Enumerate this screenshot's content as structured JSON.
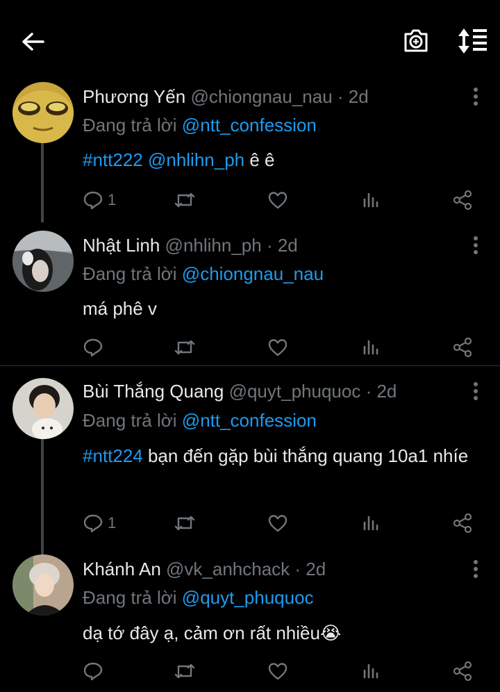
{
  "icons": {
    "back": "arrow-left-icon",
    "camera": "camera-plus-icon",
    "sort": "sort-icon",
    "more": "more-vertical-icon",
    "reply": "reply-icon",
    "retweet": "retweet-icon",
    "like": "heart-icon",
    "views": "bar-chart-icon",
    "share": "share-icon"
  },
  "colors": {
    "accent": "#1d9bf0",
    "muted": "#71767b",
    "background": "#000000"
  },
  "replying_prefix": "Đang trả lời",
  "tweets": [
    {
      "name": "Phương Yến",
      "handle": "@chiongnau_nau",
      "time": "· 2d",
      "reply_to": "@ntt_confession",
      "text_tag": "#ntt222 @nhlihn_ph",
      "text_rest": " ê ê",
      "reply_count": "1"
    },
    {
      "name": "Nhật Linh",
      "handle": "@nhlihn_ph",
      "time": "· 2d",
      "reply_to": "@chiongnau_nau",
      "text_tag": "",
      "text_rest": "má phê v",
      "reply_count": ""
    },
    {
      "name": "Bùi Thắng Quang",
      "handle": "@quyt_phuquoc",
      "time": "· 2d",
      "reply_to": "@ntt_confession",
      "text_tag": "#ntt224",
      "text_rest": " bạn đến gặp bùi thắng quang 10a1 nhíe",
      "reply_count": "1"
    },
    {
      "name": "Khánh An",
      "handle": "@vk_anhchack",
      "time": "· 2d",
      "reply_to": "@quyt_phuquoc",
      "text_tag": "",
      "text_rest": "dạ tớ đây ạ, cảm ơn rất nhiều😭",
      "reply_count": ""
    }
  ]
}
